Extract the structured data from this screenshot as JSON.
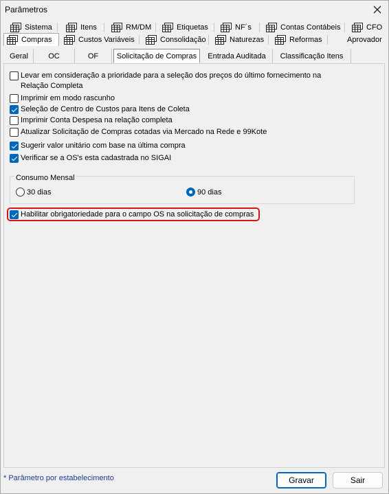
{
  "window": {
    "title": "Parâmetros",
    "close_glyph": "✕"
  },
  "tabs_row1": [
    {
      "label": "Sistema",
      "icon": "table-icon"
    },
    {
      "label": "Itens",
      "icon": "table-icon"
    },
    {
      "label": "RM/DM",
      "icon": "table-icon"
    },
    {
      "label": "Etiquetas",
      "icon": "table-icon"
    },
    {
      "label": "NF´s",
      "icon": "table-icon"
    },
    {
      "label": "Contas Contábeis",
      "icon": "table-icon"
    },
    {
      "label": "CFO",
      "icon": "table-icon"
    }
  ],
  "tabs_row2": [
    {
      "label": "Compras",
      "icon": "table-icon",
      "active": true
    },
    {
      "label": "Custos Variáveis",
      "icon": "table-icon"
    },
    {
      "label": "Consolidação",
      "icon": "table-icon"
    },
    {
      "label": "Naturezas",
      "icon": "table-icon"
    },
    {
      "label": "Reformas",
      "icon": "table-icon"
    },
    {
      "label": "Aprovador"
    }
  ],
  "subtabs": [
    {
      "label": "Geral"
    },
    {
      "label": "OC"
    },
    {
      "label": "OF"
    },
    {
      "label": "Solicitação de Compras",
      "active": true
    },
    {
      "label": "Entrada Auditada"
    },
    {
      "label": "Classificação Itens"
    }
  ],
  "options": [
    {
      "label": "Levar em consideração a prioridade para a seleção dos preços do último fornecimento na",
      "label2": "Relação Completa",
      "checked": false
    },
    {
      "label": "Imprimir em modo rascunho",
      "checked": false
    },
    {
      "label": "Seleção de Centro de Custos para Itens de Coleta",
      "checked": true
    },
    {
      "label": "Imprimir Conta Despesa na relação completa",
      "checked": false
    },
    {
      "label": "Atualizar Solicitação de Compras cotadas via Mercado na Rede e 99Kote",
      "checked": false
    },
    {
      "label": "Sugerir valor unitário com base na última compra",
      "checked": true
    },
    {
      "label": "Verificar se a OS's esta cadastrada no SIGAI",
      "checked": true
    }
  ],
  "consumo": {
    "title": "Consumo Mensal",
    "opt30": "30 dias",
    "opt90": "90 dias",
    "selected": "90 dias"
  },
  "habilitar": {
    "label": "Habilitar obrigatoriedade para o campo OS na solicitação de compras",
    "checked": true
  },
  "footer": {
    "note": "* Parâmetro por estabelecimento",
    "save": "Gravar",
    "exit": "Sair"
  },
  "colors": {
    "accent": "#0067c0",
    "highlight": "#d9141b"
  }
}
